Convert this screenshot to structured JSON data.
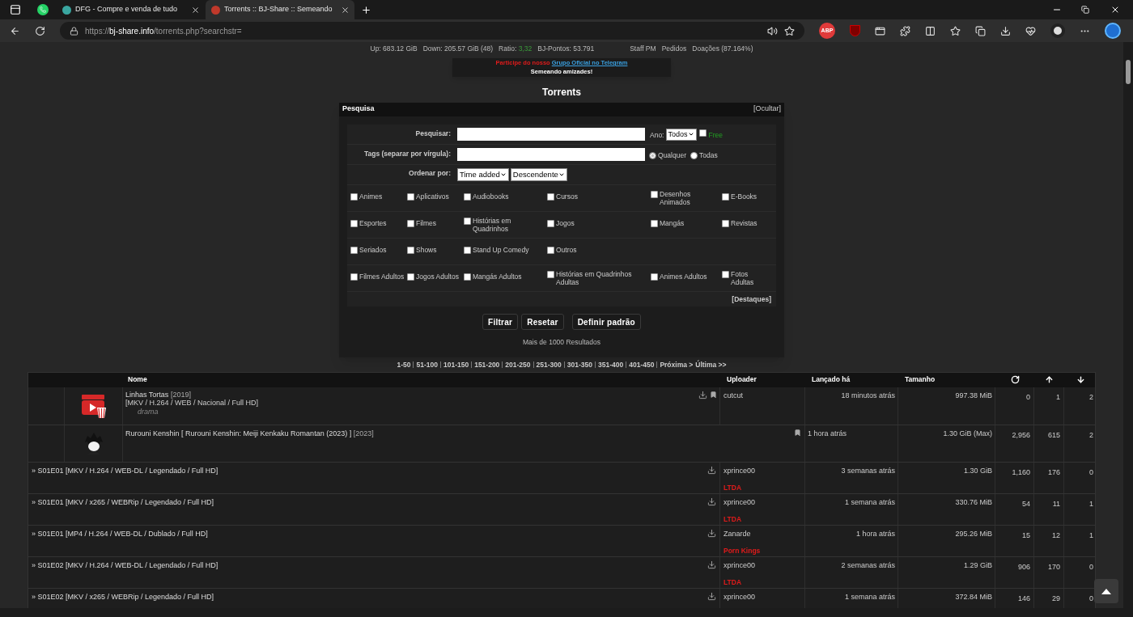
{
  "browser": {
    "tabs": [
      {
        "kind": "pinned",
        "selected": false
      },
      {
        "kind": "tab",
        "title": "DFG - Compre e venda de tudo",
        "selected": false
      },
      {
        "kind": "tab",
        "title": "Torrents :: BJ-Share :: Semeando",
        "selected": true
      }
    ],
    "url": {
      "scheme": "https://",
      "host": "bj-share.info",
      "path": "/torrents.php?searchstr="
    },
    "adblock_badge": "ABP"
  },
  "user_bar": {
    "stats": [
      {
        "kind": "plain",
        "text": "Up: 683.12 GiB"
      },
      {
        "kind": "plain",
        "text": "Down: 205.57 GiB (48)"
      },
      {
        "kind": "ratio",
        "label": "Ratio:",
        "value": "3,32"
      },
      {
        "kind": "plain",
        "text": "BJ-Pontos: 53.791"
      }
    ],
    "links": [
      "Staff PM",
      "Pedidos",
      "Doações (87.164%)"
    ]
  },
  "notice": {
    "lead": "Participe do nosso",
    "link": "Grupo Oficial no Telegram",
    "line2": "Semeando amizades!"
  },
  "page_title": "Torrents",
  "search": {
    "title": "Pesquisa",
    "toggle": "[Ocultar]",
    "search_label": "Pesquisar:",
    "year_label": "Ano:",
    "year_value": "Todos",
    "free": {
      "label": "Free",
      "checked": false
    },
    "tags_label": "Tags (separar por vírgula):",
    "tag_modes": [
      {
        "label": "Qualquer",
        "selected": true
      },
      {
        "label": "Todas",
        "selected": false
      }
    ],
    "order_label": "Ordenar por:",
    "order_field": "Time added",
    "order_direction": "Descendente",
    "categories": [
      [
        {
          "label": "Animes",
          "checked": false
        },
        {
          "label": "Aplicativos",
          "checked": false
        },
        {
          "label": "Audiobooks",
          "checked": false
        },
        {
          "label": "Cursos",
          "checked": false
        },
        {
          "label": "Desenhos Animados",
          "checked": false
        },
        {
          "label": "E-Books",
          "checked": false
        }
      ],
      [
        {
          "label": "Esportes",
          "checked": false
        },
        {
          "label": "Filmes",
          "checked": false
        },
        {
          "label": "Histórias em Quadrinhos",
          "checked": false
        },
        {
          "label": "Jogos",
          "checked": false
        },
        {
          "label": "Mangás",
          "checked": false
        },
        {
          "label": "Revistas",
          "checked": false
        }
      ],
      [
        {
          "label": "Seriados",
          "checked": false
        },
        {
          "label": "Shows",
          "checked": false
        },
        {
          "label": "Stand Up Comedy",
          "checked": false
        },
        {
          "label": "Outros",
          "checked": false
        }
      ],
      [
        {
          "label": "Filmes Adultos",
          "checked": false
        },
        {
          "label": "Jogos Adultos",
          "checked": false
        },
        {
          "label": "Mangás Adultos",
          "checked": false
        },
        {
          "label": "Histórias em Quadrinhos Adultas",
          "checked": false
        },
        {
          "label": "Animes Adultos",
          "checked": false
        },
        {
          "label": "Fotos Adultas",
          "checked": false
        }
      ]
    ],
    "highlights": "[Destaques]",
    "buttons": [
      "Filtrar",
      "Resetar",
      "Definir padrão"
    ],
    "results": "Mais de 1000 Resultados"
  },
  "pagination": {
    "pages": [
      "1-50",
      "51-100",
      "101-150",
      "151-200",
      "201-250",
      "251-300",
      "301-350",
      "351-400",
      "401-450"
    ],
    "next": "Próxima >",
    "last": "Última >>"
  },
  "table": {
    "columns": {
      "name": "Nome",
      "uploader": "Uploader",
      "age": "Lançado há",
      "size": "Tamanho"
    },
    "rows": [
      {
        "kind": "movie",
        "title": "Linhas Tortas",
        "year": "[2019]",
        "tags": "[MKV / H.264 / WEB / Nacional / Full HD]",
        "genre": "drama",
        "uploader": "cutcut",
        "age": "18 minutos atrás",
        "size": "997.38 MiB",
        "snatched": "0",
        "seeders": "1",
        "leechers": "2"
      },
      {
        "kind": "series",
        "title": "Rurouni Kenshin [ Rurouni Kenshin: Meiji Kenkaku Romantan (2023) ]",
        "year": "[2023]",
        "age": "1 hora atrás",
        "size": "1.30 GiB (Max)",
        "snatched": "2,956",
        "seeders": "615",
        "leechers": "2"
      },
      {
        "kind": "episode",
        "title": "» S01E01 [MKV / H.264 / WEB-DL / Legendado / Full HD]",
        "uploader": "xprince00",
        "group": "LTDA",
        "age": "3 semanas atrás",
        "size": "1.30 GiB",
        "snatched": "1,160",
        "seeders": "176",
        "leechers": "0"
      },
      {
        "kind": "episode",
        "title": "» S01E01 [MKV / x265 / WEBRip / Legendado / Full HD]",
        "uploader": "xprince00",
        "group": "LTDA",
        "age": "1 semana atrás",
        "size": "330.76 MiB",
        "snatched": "54",
        "seeders": "11",
        "leechers": "1"
      },
      {
        "kind": "episode",
        "title": "» S01E01 [MP4 / H.264 / WEB-DL / Dublado / Full HD]",
        "uploader": "Zanarde",
        "group": "Porn Kings",
        "age": "1 hora atrás",
        "size": "295.26 MiB",
        "snatched": "15",
        "seeders": "12",
        "leechers": "1"
      },
      {
        "kind": "episode",
        "title": "» S01E02 [MKV / H.264 / WEB-DL / Legendado / Full HD]",
        "uploader": "xprince00",
        "group": "LTDA",
        "age": "2 semanas atrás",
        "size": "1.29 GiB",
        "snatched": "906",
        "seeders": "170",
        "leechers": "0"
      },
      {
        "kind": "episode",
        "title": "» S01E02 [MKV / x265 / WEBRip / Legendado / Full HD]",
        "uploader": "xprince00",
        "age": "1 semana atrás",
        "size": "372.84 MiB",
        "snatched": "146",
        "seeders": "29",
        "leechers": "0"
      }
    ]
  }
}
